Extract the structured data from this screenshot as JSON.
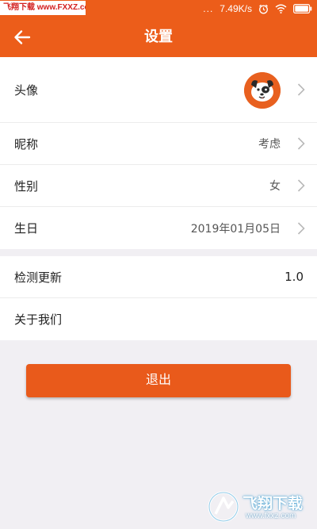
{
  "status_bar": {
    "watermark": "飞翔下载 www.FXXZ.com",
    "signal_dots": "...",
    "speed": "7.49K/s"
  },
  "header": {
    "title": "设置"
  },
  "settings": {
    "avatar_label": "头像",
    "nickname_label": "昵称",
    "nickname_value": "考虑",
    "gender_label": "性别",
    "gender_value": "女",
    "birthday_label": "生日",
    "birthday_value": "2019年01月05日"
  },
  "about": {
    "update_label": "检测更新",
    "update_value": "1.0",
    "about_label": "关于我们"
  },
  "logout_label": "退出",
  "watermark": {
    "title": "飞翔下载",
    "url": "www.fxxz.com"
  },
  "colors": {
    "accent": "#ec5d1a",
    "background": "#f1eff3"
  }
}
